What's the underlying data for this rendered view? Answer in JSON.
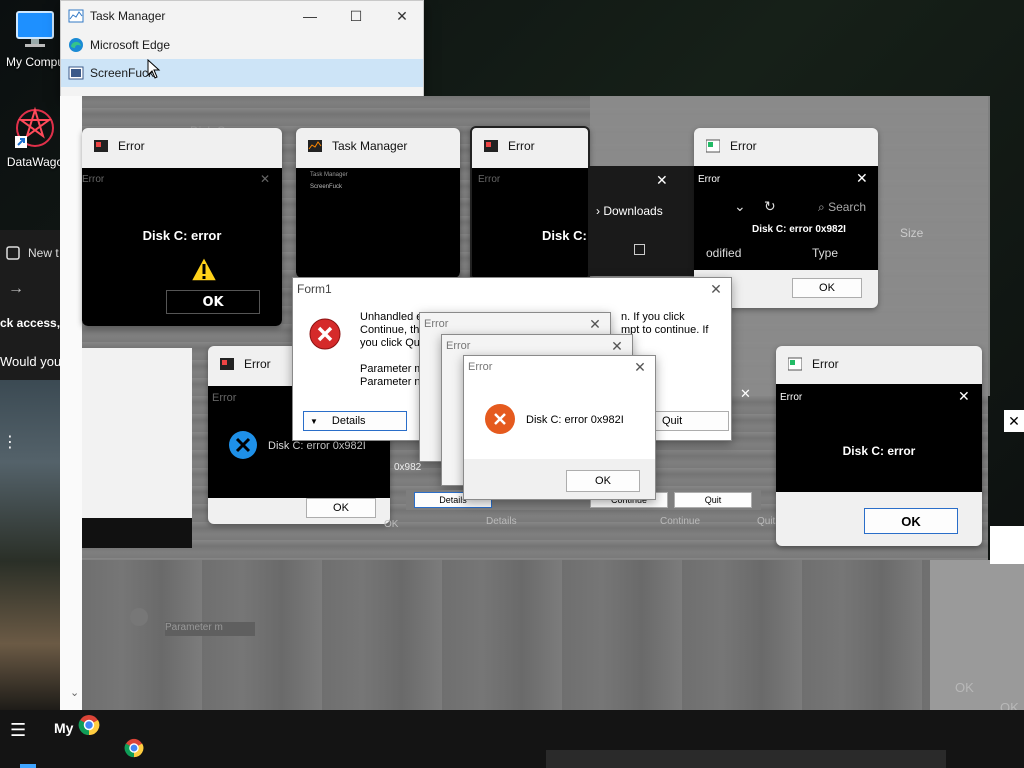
{
  "desktop": {
    "icons": [
      {
        "label": "My Compu",
        "icon": "monitor-icon"
      },
      {
        "label": "DataWago",
        "icon": "datawago-icon"
      }
    ],
    "partial_texts": {
      "new_tab": "New t",
      "access": "ck access, p",
      "would_you": "Would you"
    }
  },
  "jump_list": {
    "title": "Task Manager",
    "items": [
      {
        "label": "Microsoft Edge",
        "icon": "edge-icon"
      },
      {
        "label": "ScreenFuck",
        "icon": "screenfuck-icon"
      }
    ],
    "controls": {
      "minimize": "—",
      "maximize": "☐",
      "close": "✕"
    }
  },
  "switcher": {
    "thumbnails": [
      {
        "title": "Error",
        "dialog_title": "Error",
        "message": "Disk C: error",
        "ok": "OK"
      },
      {
        "title": "Task Manager",
        "mini_row1": "Task Manager",
        "mini_row2": "ScreenFuck"
      },
      {
        "title": "Error",
        "dialog_title": "Error",
        "message": "Disk C: error"
      },
      {
        "title": "Error",
        "dialog_title": "Error",
        "downloads": "Downloads",
        "search": "Search",
        "size": "Size",
        "modified": "odified",
        "type": "Type",
        "message": "Disk C: error 0x982I",
        "ok": "OK"
      },
      {
        "title": "Error",
        "dialog_title": "Error",
        "message": "Disk C: error 0x982I",
        "ok": "OK"
      },
      {
        "title": "Error",
        "dialog_title": "Error",
        "message": "Disk C: error",
        "ok": "OK"
      }
    ]
  },
  "form1": {
    "title": "Form1",
    "message_lines": [
      "Unhandled e",
      "Continue, the",
      "you click Qui"
    ],
    "message_right": [
      "n. If you click",
      "mpt to continue. If"
    ],
    "param_lines": [
      "Parameter m",
      "Parameter na"
    ],
    "details_label": "Details",
    "quit_label": "Quit",
    "continue_label": "Continue"
  },
  "stacked_errors": [
    {
      "title": "Error"
    },
    {
      "title": "Error"
    }
  ],
  "main_error": {
    "title": "Error",
    "message": "Disk C: error 0x982I",
    "ok_label": "OK"
  },
  "glitch_labels": {
    "details": "Details",
    "continue": "Continue",
    "quit": "Quit",
    "ok": "OK",
    "disk_ghost": "Disk C",
    "param_ghost": "Parameter m",
    "fragment": "0x982"
  },
  "taskbar": {
    "menu_label": "My"
  }
}
